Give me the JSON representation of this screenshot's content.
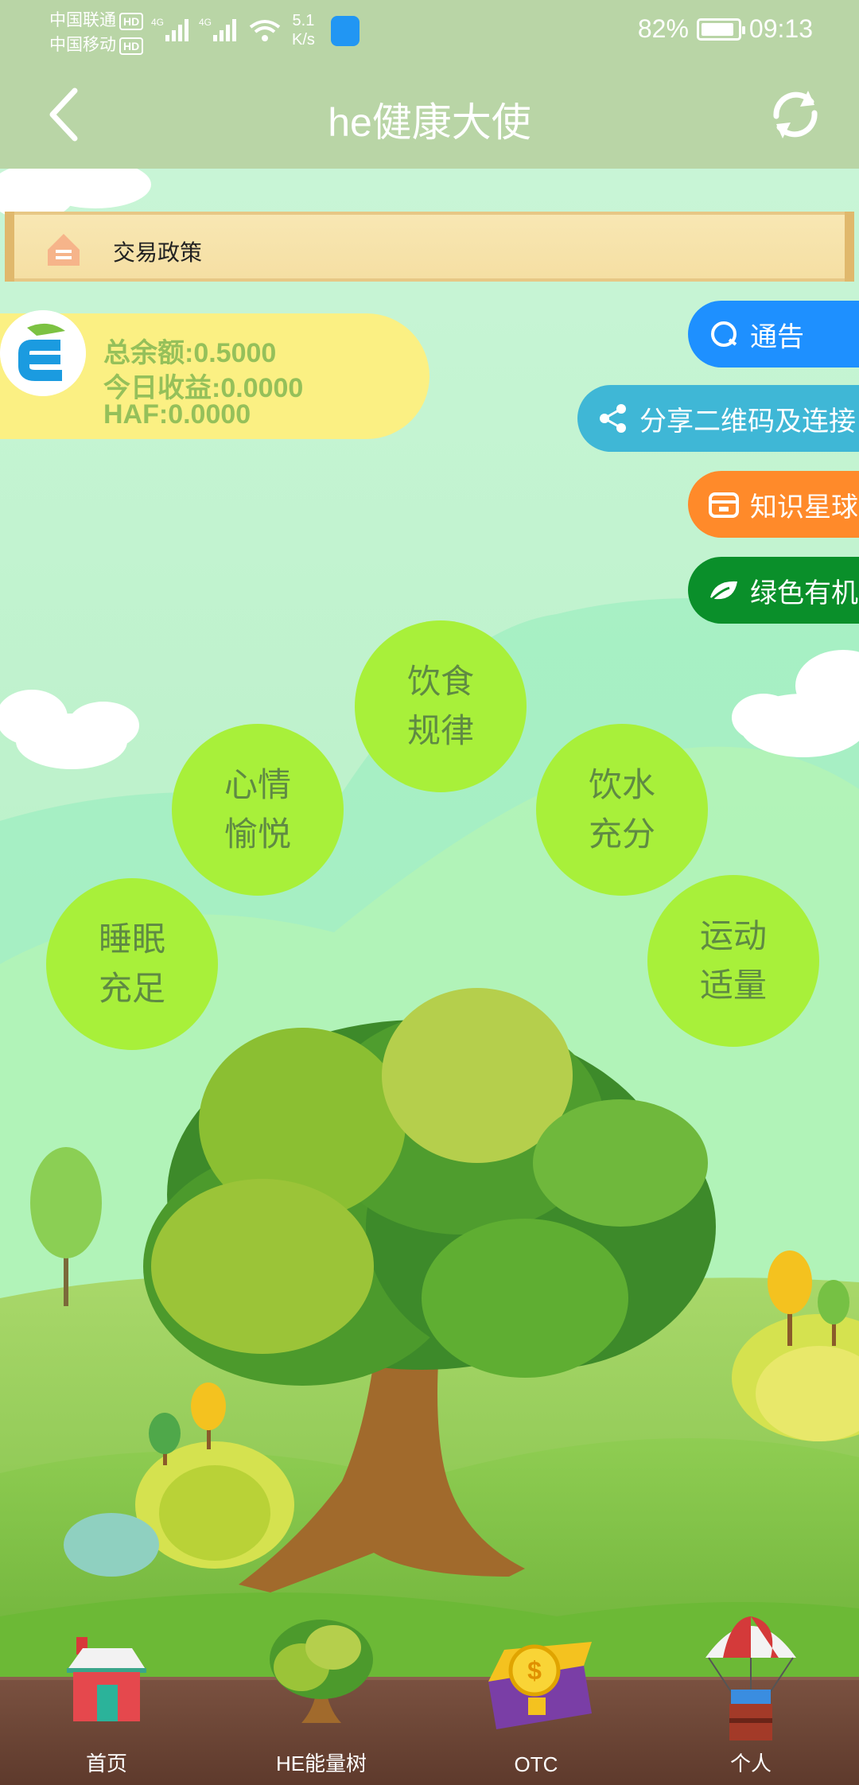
{
  "status": {
    "carrier1": "中国联通",
    "carrier2": "中国移动",
    "hd": "HD",
    "net": "4G",
    "speed_value": "5.1",
    "speed_unit": "K/s",
    "battery": "82%",
    "time": "09:13"
  },
  "header": {
    "title": "he健康大使",
    "back_icon": "chevron-left-icon",
    "refresh_icon": "refresh-icon"
  },
  "notice": {
    "text": "交易政策",
    "icon": "notice-icon"
  },
  "balance": {
    "total": "总余额:0.5000",
    "today": "今日收益:0.0000",
    "haf": "HAF:0.0000"
  },
  "side_buttons": [
    {
      "label": "通告",
      "color": "#1e90ff",
      "icon": "message-icon"
    },
    {
      "label": "分享二维码及连接",
      "color": "#3fb7d6",
      "icon": "share-icon"
    },
    {
      "label": "知识星球",
      "color": "#ff8a2a",
      "icon": "store-icon"
    },
    {
      "label": "绿色有机",
      "color": "#0a8f2a",
      "icon": "leaf-icon"
    }
  ],
  "bubbles": [
    {
      "line1": "饮食",
      "line2": "规律"
    },
    {
      "line1": "心情",
      "line2": "愉悦"
    },
    {
      "line1": "饮水",
      "line2": "充分"
    },
    {
      "line1": "睡眠",
      "line2": "充足"
    },
    {
      "line1": "运动",
      "line2": "适量"
    }
  ],
  "nav": [
    {
      "label": "首页",
      "icon": "house-icon"
    },
    {
      "label": "HE能量树",
      "icon": "tree-icon"
    },
    {
      "label": "OTC",
      "icon": "treasure-chest-icon"
    },
    {
      "label": "个人",
      "icon": "parachute-crate-icon"
    }
  ]
}
